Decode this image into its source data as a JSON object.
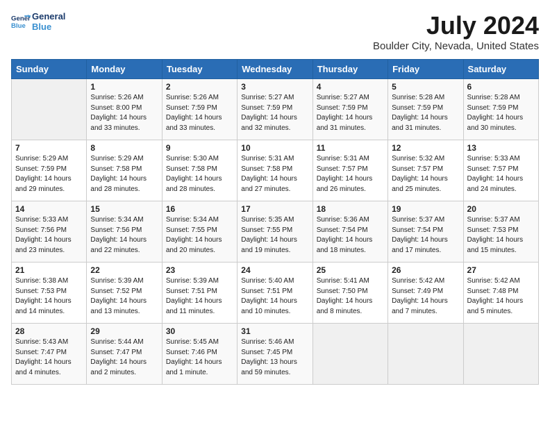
{
  "header": {
    "logo_line1": "General",
    "logo_line2": "Blue",
    "month": "July 2024",
    "location": "Boulder City, Nevada, United States"
  },
  "days_of_week": [
    "Sunday",
    "Monday",
    "Tuesday",
    "Wednesday",
    "Thursday",
    "Friday",
    "Saturday"
  ],
  "weeks": [
    [
      {
        "day": "",
        "info": ""
      },
      {
        "day": "1",
        "info": "Sunrise: 5:26 AM\nSunset: 8:00 PM\nDaylight: 14 hours\nand 33 minutes."
      },
      {
        "day": "2",
        "info": "Sunrise: 5:26 AM\nSunset: 7:59 PM\nDaylight: 14 hours\nand 33 minutes."
      },
      {
        "day": "3",
        "info": "Sunrise: 5:27 AM\nSunset: 7:59 PM\nDaylight: 14 hours\nand 32 minutes."
      },
      {
        "day": "4",
        "info": "Sunrise: 5:27 AM\nSunset: 7:59 PM\nDaylight: 14 hours\nand 31 minutes."
      },
      {
        "day": "5",
        "info": "Sunrise: 5:28 AM\nSunset: 7:59 PM\nDaylight: 14 hours\nand 31 minutes."
      },
      {
        "day": "6",
        "info": "Sunrise: 5:28 AM\nSunset: 7:59 PM\nDaylight: 14 hours\nand 30 minutes."
      }
    ],
    [
      {
        "day": "7",
        "info": "Sunrise: 5:29 AM\nSunset: 7:59 PM\nDaylight: 14 hours\nand 29 minutes."
      },
      {
        "day": "8",
        "info": "Sunrise: 5:29 AM\nSunset: 7:58 PM\nDaylight: 14 hours\nand 28 minutes."
      },
      {
        "day": "9",
        "info": "Sunrise: 5:30 AM\nSunset: 7:58 PM\nDaylight: 14 hours\nand 28 minutes."
      },
      {
        "day": "10",
        "info": "Sunrise: 5:31 AM\nSunset: 7:58 PM\nDaylight: 14 hours\nand 27 minutes."
      },
      {
        "day": "11",
        "info": "Sunrise: 5:31 AM\nSunset: 7:57 PM\nDaylight: 14 hours\nand 26 minutes."
      },
      {
        "day": "12",
        "info": "Sunrise: 5:32 AM\nSunset: 7:57 PM\nDaylight: 14 hours\nand 25 minutes."
      },
      {
        "day": "13",
        "info": "Sunrise: 5:33 AM\nSunset: 7:57 PM\nDaylight: 14 hours\nand 24 minutes."
      }
    ],
    [
      {
        "day": "14",
        "info": "Sunrise: 5:33 AM\nSunset: 7:56 PM\nDaylight: 14 hours\nand 23 minutes."
      },
      {
        "day": "15",
        "info": "Sunrise: 5:34 AM\nSunset: 7:56 PM\nDaylight: 14 hours\nand 22 minutes."
      },
      {
        "day": "16",
        "info": "Sunrise: 5:34 AM\nSunset: 7:55 PM\nDaylight: 14 hours\nand 20 minutes."
      },
      {
        "day": "17",
        "info": "Sunrise: 5:35 AM\nSunset: 7:55 PM\nDaylight: 14 hours\nand 19 minutes."
      },
      {
        "day": "18",
        "info": "Sunrise: 5:36 AM\nSunset: 7:54 PM\nDaylight: 14 hours\nand 18 minutes."
      },
      {
        "day": "19",
        "info": "Sunrise: 5:37 AM\nSunset: 7:54 PM\nDaylight: 14 hours\nand 17 minutes."
      },
      {
        "day": "20",
        "info": "Sunrise: 5:37 AM\nSunset: 7:53 PM\nDaylight: 14 hours\nand 15 minutes."
      }
    ],
    [
      {
        "day": "21",
        "info": "Sunrise: 5:38 AM\nSunset: 7:53 PM\nDaylight: 14 hours\nand 14 minutes."
      },
      {
        "day": "22",
        "info": "Sunrise: 5:39 AM\nSunset: 7:52 PM\nDaylight: 14 hours\nand 13 minutes."
      },
      {
        "day": "23",
        "info": "Sunrise: 5:39 AM\nSunset: 7:51 PM\nDaylight: 14 hours\nand 11 minutes."
      },
      {
        "day": "24",
        "info": "Sunrise: 5:40 AM\nSunset: 7:51 PM\nDaylight: 14 hours\nand 10 minutes."
      },
      {
        "day": "25",
        "info": "Sunrise: 5:41 AM\nSunset: 7:50 PM\nDaylight: 14 hours\nand 8 minutes."
      },
      {
        "day": "26",
        "info": "Sunrise: 5:42 AM\nSunset: 7:49 PM\nDaylight: 14 hours\nand 7 minutes."
      },
      {
        "day": "27",
        "info": "Sunrise: 5:42 AM\nSunset: 7:48 PM\nDaylight: 14 hours\nand 5 minutes."
      }
    ],
    [
      {
        "day": "28",
        "info": "Sunrise: 5:43 AM\nSunset: 7:47 PM\nDaylight: 14 hours\nand 4 minutes."
      },
      {
        "day": "29",
        "info": "Sunrise: 5:44 AM\nSunset: 7:47 PM\nDaylight: 14 hours\nand 2 minutes."
      },
      {
        "day": "30",
        "info": "Sunrise: 5:45 AM\nSunset: 7:46 PM\nDaylight: 14 hours\nand 1 minute."
      },
      {
        "day": "31",
        "info": "Sunrise: 5:46 AM\nSunset: 7:45 PM\nDaylight: 13 hours\nand 59 minutes."
      },
      {
        "day": "",
        "info": ""
      },
      {
        "day": "",
        "info": ""
      },
      {
        "day": "",
        "info": ""
      }
    ]
  ]
}
